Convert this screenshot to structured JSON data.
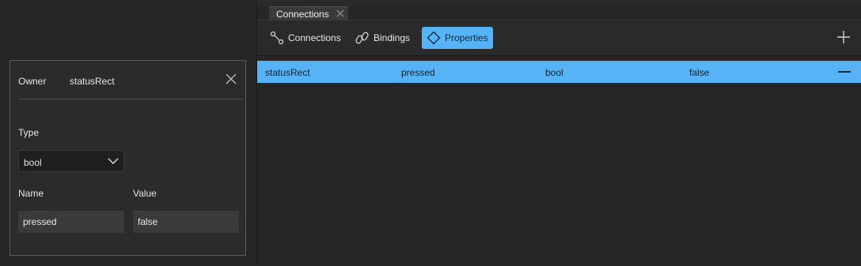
{
  "dialog": {
    "owner_label": "Owner",
    "owner_value": "statusRect",
    "type_label": "Type",
    "type_value": "bool",
    "name_label": "Name",
    "value_label": "Value",
    "name_value": "pressed",
    "value_value": "false"
  },
  "tab": {
    "label": "Connections"
  },
  "toolbar": {
    "connections": "Connections",
    "bindings": "Bindings",
    "properties": "Properties"
  },
  "table": {
    "rows": [
      {
        "owner": "statusRect",
        "name": "pressed",
        "type": "bool",
        "value": "false"
      }
    ]
  },
  "colors": {
    "accent": "#56b3f5",
    "background": "#262626",
    "panel": "#2b2b2b"
  }
}
